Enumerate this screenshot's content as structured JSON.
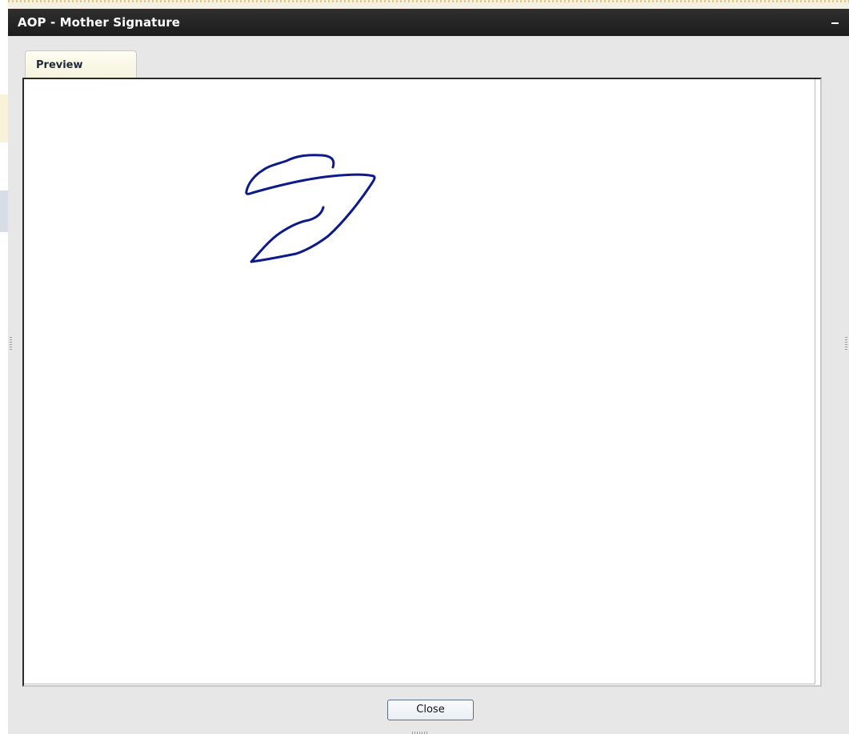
{
  "window": {
    "title": "AOP - Mother Signature",
    "minimize_icon": "minimize-icon"
  },
  "tabs": [
    {
      "label": "Preview",
      "active": true
    }
  ],
  "signature": {
    "stroke_color": "#0d1a8c"
  },
  "footer": {
    "close_label": "Close"
  }
}
